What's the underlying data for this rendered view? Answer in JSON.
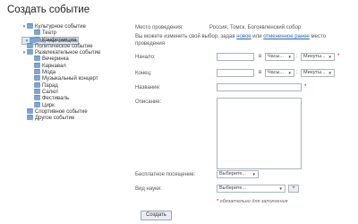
{
  "page_title": "Создать событие",
  "tree": [
    {
      "label": "Культурное событие",
      "level": 0,
      "toggle": "▼",
      "selected": false
    },
    {
      "label": "Театр",
      "level": 1,
      "toggle": "",
      "selected": false
    },
    {
      "label": "Научное событие",
      "level": 0,
      "toggle": "▼",
      "selected": true
    },
    {
      "label": "Конференция",
      "level": 1,
      "toggle": "",
      "selected": false
    },
    {
      "label": "Политическое событие",
      "level": 0,
      "toggle": "",
      "selected": false
    },
    {
      "label": "Развлекательное событие",
      "level": 0,
      "toggle": "▼",
      "selected": false
    },
    {
      "label": "Вечеринка",
      "level": 1,
      "toggle": "",
      "selected": false
    },
    {
      "label": "Карнавал",
      "level": 1,
      "toggle": "",
      "selected": false
    },
    {
      "label": "Мода",
      "level": 1,
      "toggle": "",
      "selected": false
    },
    {
      "label": "Музыкальный концерт",
      "level": 1,
      "toggle": "",
      "selected": false
    },
    {
      "label": "Парад",
      "level": 1,
      "toggle": "",
      "selected": false
    },
    {
      "label": "Салют",
      "level": 1,
      "toggle": "",
      "selected": false
    },
    {
      "label": "Фестиваль",
      "level": 1,
      "toggle": "",
      "selected": false
    },
    {
      "label": "Цирк",
      "level": 1,
      "toggle": "",
      "selected": false
    },
    {
      "label": "Спортивное событие",
      "level": 0,
      "toggle": "",
      "selected": false
    },
    {
      "label": "Другое событие",
      "level": 0,
      "toggle": "",
      "selected": false
    }
  ],
  "form": {
    "place_label": "Место проведения:",
    "place_value": "Россия, Томск, Богоявленский собор",
    "place_note_prefix": "Вы можете изменить свой выбор, задав ",
    "place_note_link_new": "новое",
    "place_note_mid": " или ",
    "place_note_link_cancel": "отмененное ранее",
    "place_note_suffix": " место проведения",
    "start_label": "Начало:",
    "end_label": "Конец:",
    "time_at": "в",
    "hours_placeholder": "Часы...",
    "time_sep": ":",
    "minutes_placeholder": "Минуты...",
    "name_label": "Название:",
    "description_label": "Описание:",
    "free_label": "Бесплатное посещение:",
    "free_select": "Выберите...",
    "science_label": "Вид науки:",
    "science_select": "Выберите...",
    "add_button": "+",
    "required_mark": "*",
    "required_note": "обязательно для заполнения",
    "submit_button": "Создать"
  }
}
